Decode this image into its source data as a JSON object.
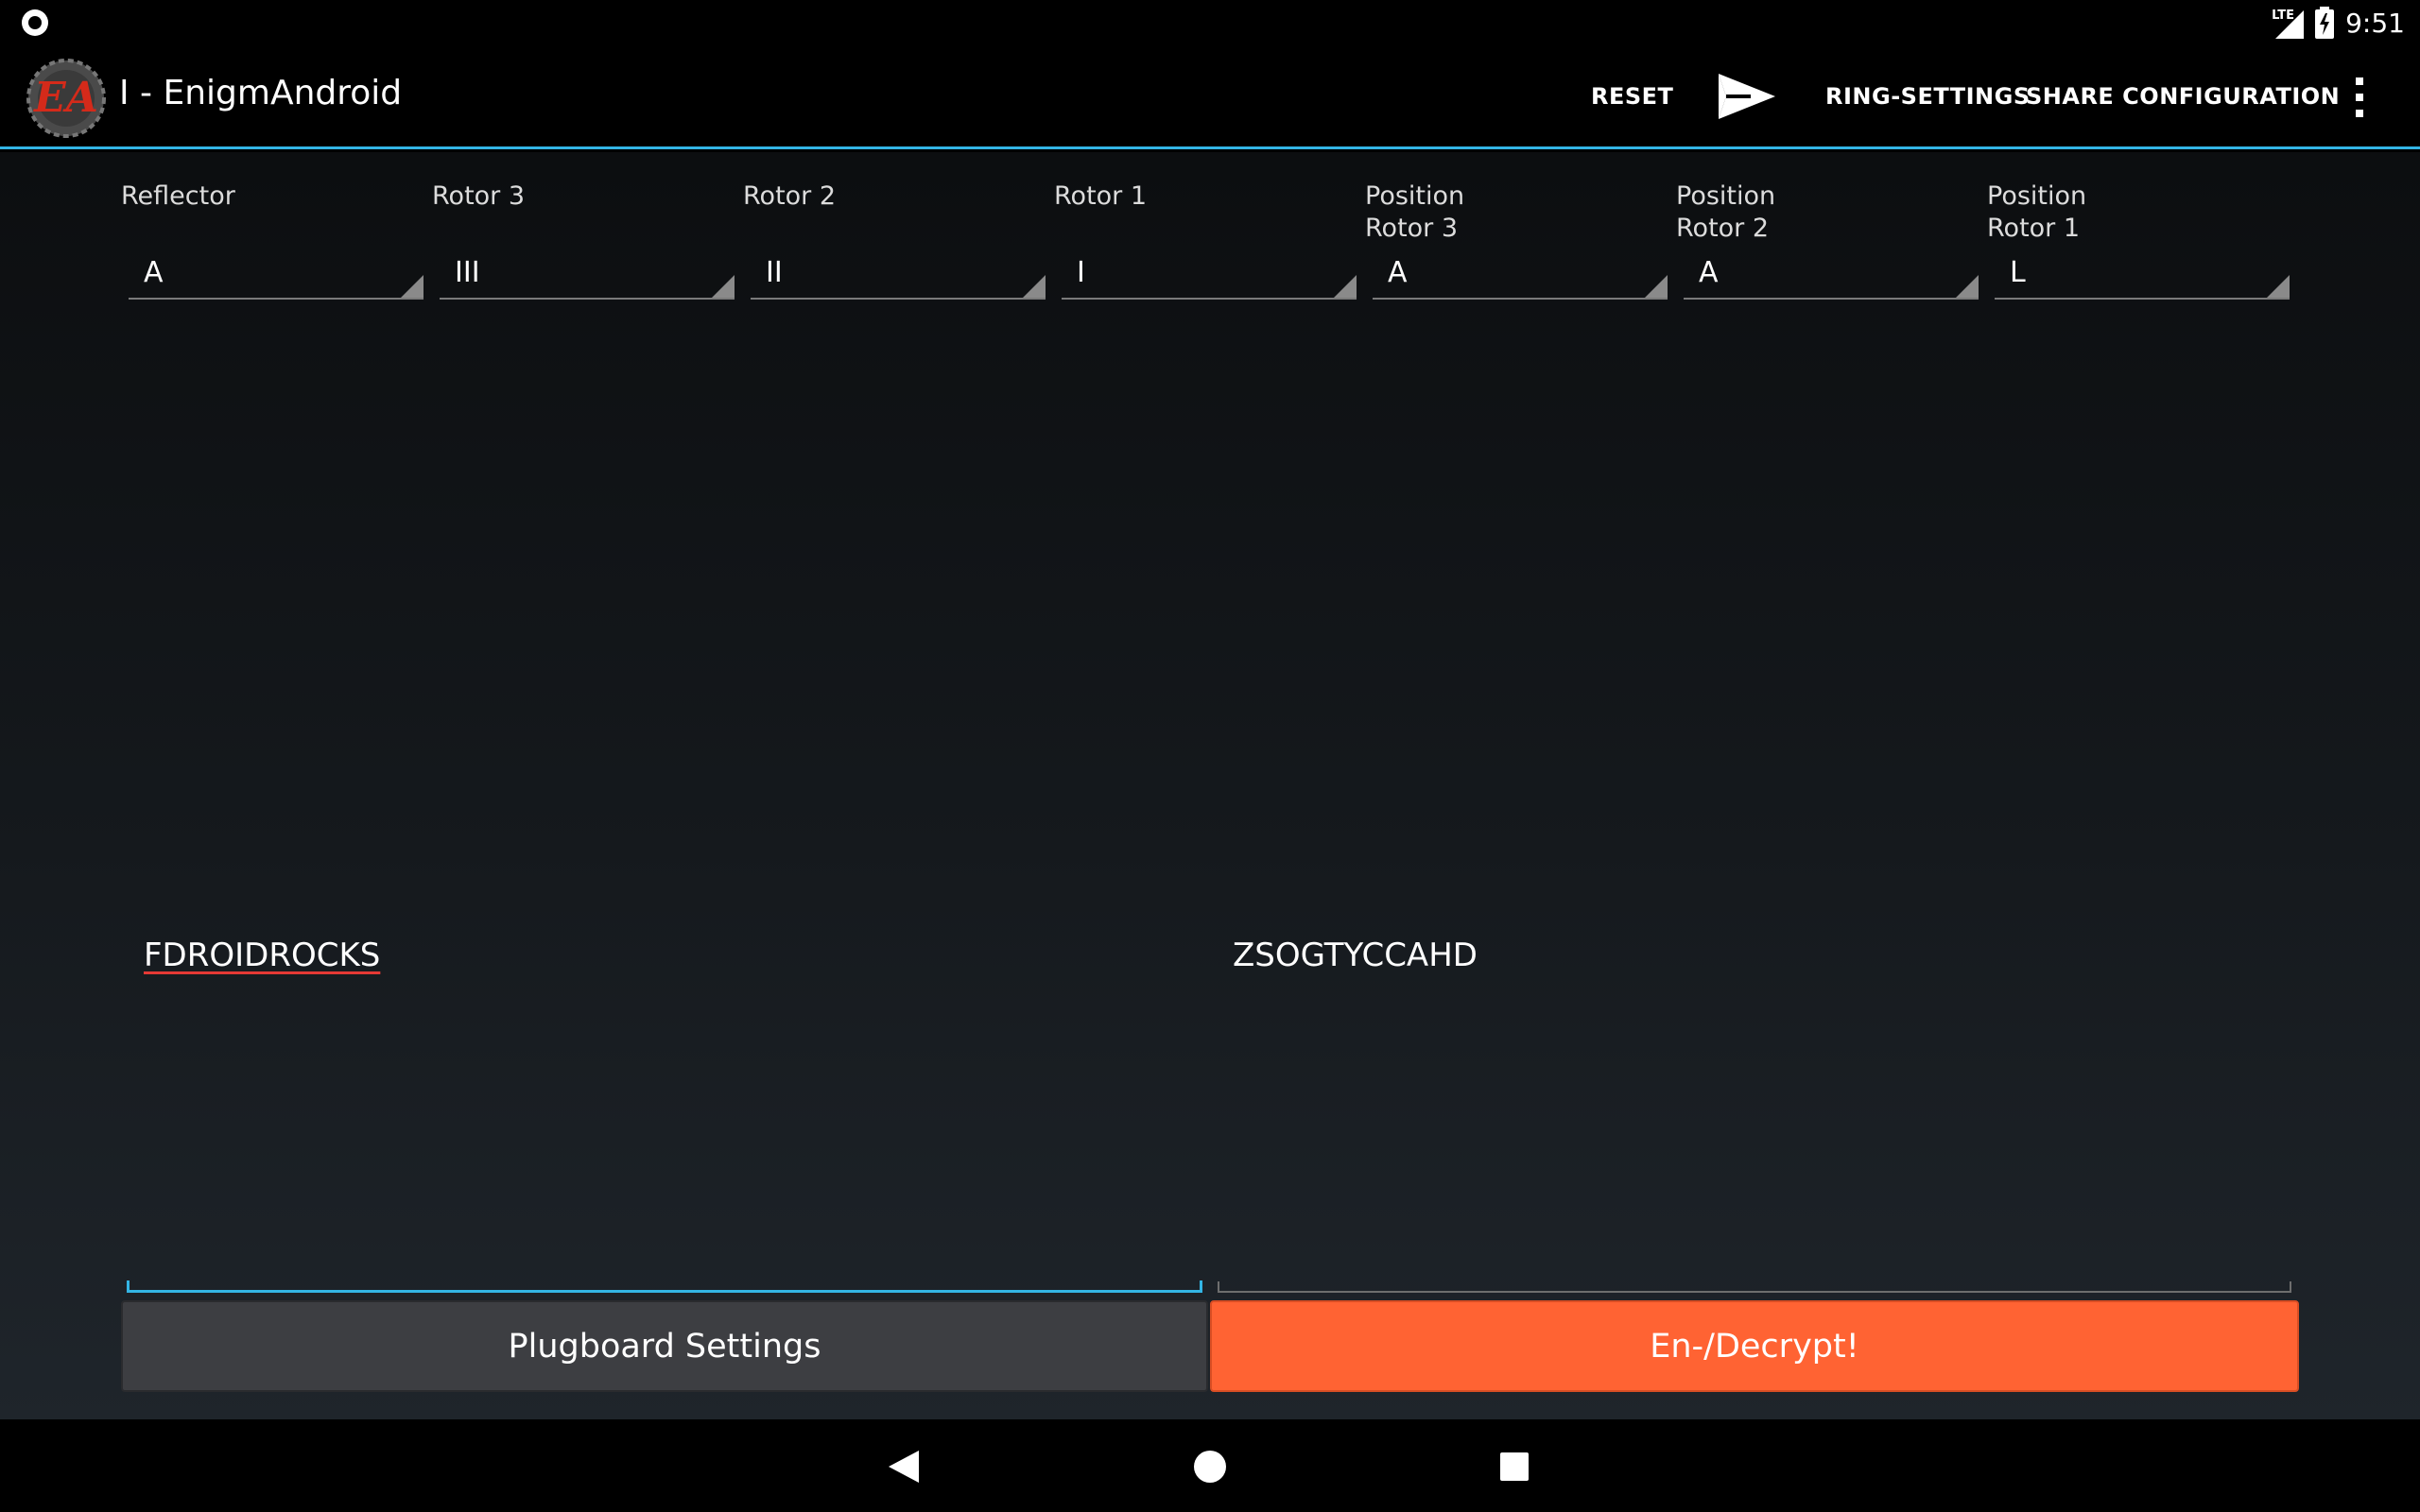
{
  "status_bar": {
    "network_label": "LTE",
    "time": "9:51",
    "icons": [
      "record-icon",
      "signal-icon",
      "battery-charging-icon"
    ]
  },
  "action_bar": {
    "title": "I - EnigmAndroid",
    "logo_text": "EA",
    "actions": {
      "reset": "RESET",
      "ring_settings": "RING-SETTINGS",
      "share_configuration": "SHARE CONFIGURATION"
    },
    "icons": [
      "app-logo-icon",
      "send-icon",
      "overflow-menu-icon"
    ],
    "accent_color": "#33b5e5"
  },
  "spinners": [
    {
      "label": "Reflector",
      "value": "A"
    },
    {
      "label": "Rotor 3",
      "value": "III"
    },
    {
      "label": "Rotor 2",
      "value": "II"
    },
    {
      "label": "Rotor 1",
      "value": "I"
    },
    {
      "label": "Position Rotor 3",
      "label_line1": "Position",
      "label_line2": "Rotor 3",
      "value": "A"
    },
    {
      "label": "Position Rotor 2",
      "label_line1": "Position",
      "label_line2": "Rotor 2",
      "value": "A"
    },
    {
      "label": "Position Rotor 1",
      "label_line1": "Position",
      "label_line2": "Rotor 1",
      "value": "L"
    }
  ],
  "input": {
    "value": "FDROIDROCKS"
  },
  "output": {
    "value": "ZSOGTYCCAHD"
  },
  "buttons": {
    "plugboard": "Plugboard Settings",
    "crypt": "En-/Decrypt!",
    "crypt_color": "#ff6333"
  },
  "nav_bar": {
    "icons": [
      "back-icon",
      "home-icon",
      "recent-apps-icon"
    ]
  }
}
